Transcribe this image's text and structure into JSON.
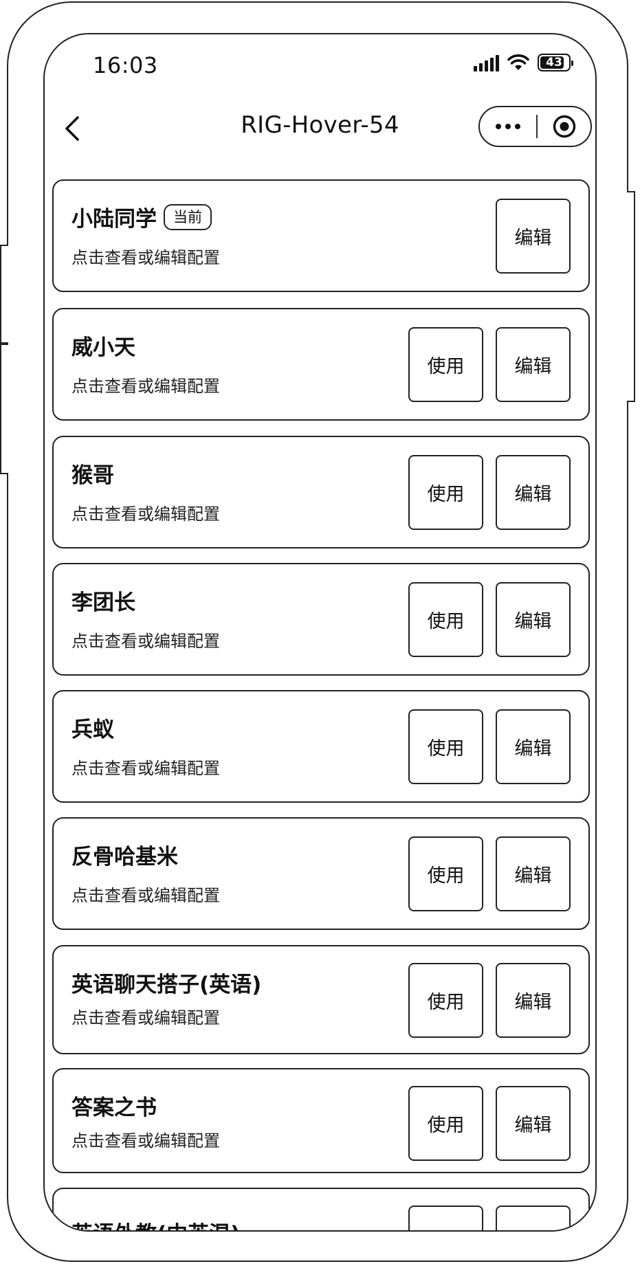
{
  "status_bar": {
    "time": "16:03",
    "battery": "43"
  },
  "nav": {
    "title": "RIG-Hover-54"
  },
  "card_common": {
    "description": "点击查看或编辑配置",
    "use_label": "使用",
    "edit_label": "编辑",
    "current_badge": "当前"
  },
  "agents": [
    {
      "name": "小陆同学",
      "is_current": true
    },
    {
      "name": "威小天",
      "is_current": false
    },
    {
      "name": "猴哥",
      "is_current": false
    },
    {
      "name": "李团长",
      "is_current": false
    },
    {
      "name": "兵蚁",
      "is_current": false
    },
    {
      "name": "反骨哈基米",
      "is_current": false
    },
    {
      "name": "英语聊天搭子(英语)",
      "is_current": false
    },
    {
      "name": "答案之书",
      "is_current": false
    },
    {
      "name": "英语外教(中英混)",
      "is_current": false
    }
  ]
}
